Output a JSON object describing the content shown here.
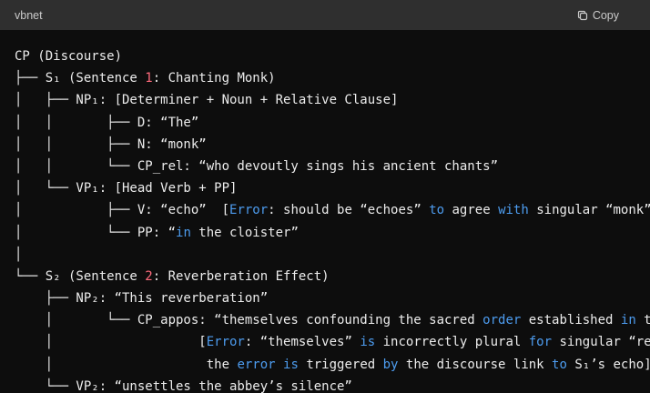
{
  "header": {
    "language": "vbnet",
    "copy_label": "Copy",
    "copy_icon": "copy-icon"
  },
  "colors": {
    "header_bg": "#2f2f2f",
    "code_bg": "#0d0d0d",
    "text": "#ececec",
    "number_red": "#ff6b7c",
    "keyword_blue": "#4d9cef"
  },
  "code": {
    "lines": [
      [
        {
          "t": "CP (Discourse)"
        }
      ],
      [
        {
          "t": "├── S₁ (Sentence "
        },
        {
          "t": "1",
          "c": "red"
        },
        {
          "t": ": Chanting Monk)"
        }
      ],
      [
        {
          "t": "│   ├── NP₁: [Determiner + Noun + Relative Clause]"
        }
      ],
      [
        {
          "t": "│   │       ├── D: “The”"
        }
      ],
      [
        {
          "t": "│   │       ├── N: “monk”"
        }
      ],
      [
        {
          "t": "│   │       └── CP_rel: “who devoutly sings his ancient chants”"
        }
      ],
      [
        {
          "t": "│   └── VP₁: [Head Verb + PP]"
        }
      ],
      [
        {
          "t": "│           ├── V: “echo”  ["
        },
        {
          "t": "Error",
          "c": "blue"
        },
        {
          "t": ": should be “echoes” "
        },
        {
          "t": "to",
          "c": "blue"
        },
        {
          "t": " agree "
        },
        {
          "t": "with",
          "c": "blue"
        },
        {
          "t": " singular “monk”]"
        }
      ],
      [
        {
          "t": "│           └── PP: “"
        },
        {
          "t": "in",
          "c": "blue"
        },
        {
          "t": " the cloister”"
        }
      ],
      [
        {
          "t": "│"
        }
      ],
      [
        {
          "t": "└── S₂ (Sentence "
        },
        {
          "t": "2",
          "c": "red"
        },
        {
          "t": ": Reverberation Effect)"
        }
      ],
      [
        {
          "t": "    ├── NP₂: “This reverberation”"
        }
      ],
      [
        {
          "t": "    │       └── CP_appos: “themselves confounding the sacred "
        },
        {
          "t": "order",
          "c": "blue"
        },
        {
          "t": " established "
        },
        {
          "t": "in",
          "c": "blue"
        },
        {
          "t": " the"
        }
      ],
      [
        {
          "t": "    │                   ["
        },
        {
          "t": "Error",
          "c": "blue"
        },
        {
          "t": ": “themselves” "
        },
        {
          "t": "is",
          "c": "blue"
        },
        {
          "t": " incorrectly plural "
        },
        {
          "t": "for",
          "c": "blue"
        },
        {
          "t": " singular “reverberation”;"
        }
      ],
      [
        {
          "t": "    │                    the "
        },
        {
          "t": "error",
          "c": "blue"
        },
        {
          "t": " "
        },
        {
          "t": "is",
          "c": "blue"
        },
        {
          "t": " triggered "
        },
        {
          "t": "by",
          "c": "blue"
        },
        {
          "t": " the discourse link "
        },
        {
          "t": "to",
          "c": "blue"
        },
        {
          "t": " S₁’s echo]"
        }
      ],
      [
        {
          "t": "    └── VP₂: “unsettles the abbey’s silence”"
        }
      ]
    ]
  }
}
